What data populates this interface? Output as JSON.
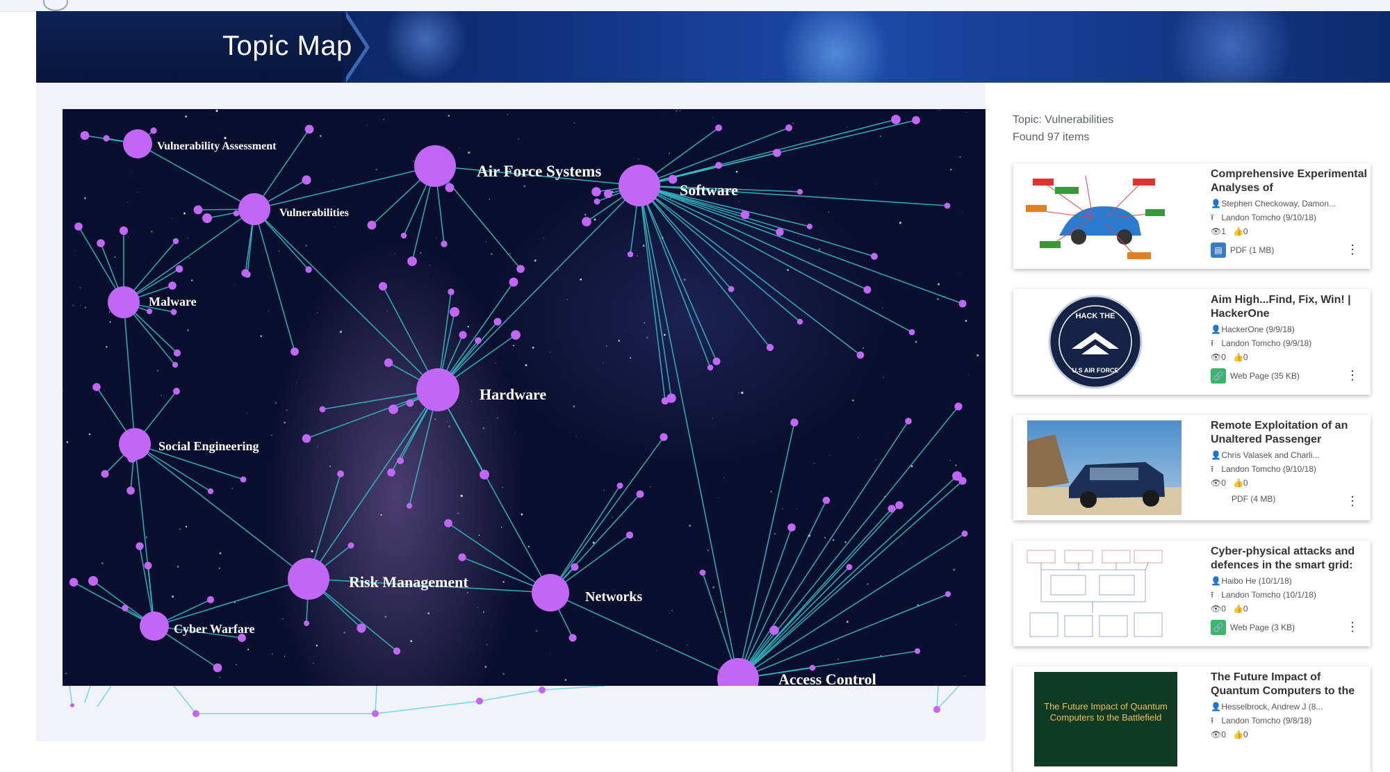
{
  "banner": {
    "title": "Topic Map"
  },
  "panel": {
    "topic_line": "Topic: Vulnerabilities",
    "found_line": "Found 97 items"
  },
  "colors": {
    "node": "#c266f5",
    "edge": "#33c1c9",
    "banner_dark": "#0a1c4a",
    "pdf_icon": "#3a7bc8",
    "link_icon": "#3db56b"
  },
  "topics": [
    {
      "label": "Vulnerability Assessment"
    },
    {
      "label": "Air Force Systems"
    },
    {
      "label": "Software"
    },
    {
      "label": "Vulnerabilities"
    },
    {
      "label": "Malware"
    },
    {
      "label": "Hardware"
    },
    {
      "label": "Social Engineering"
    },
    {
      "label": "Risk Management"
    },
    {
      "label": "Networks"
    },
    {
      "label": "Cyber Warfare"
    },
    {
      "label": "Access Control"
    }
  ],
  "results": [
    {
      "title": "Comprehensive Experimental Analyses of",
      "author": "Stephen Checkoway, Damon...",
      "uploader": "Landon Tomcho (9/10/18)",
      "views": "1",
      "likes": "0",
      "type": "PDF (1 MB)",
      "type_icon": "pdf-icon"
    },
    {
      "title": "Aim High...Find, Fix, Win! | HackerOne",
      "author": "HackerOne (9/9/18)",
      "uploader": "Landon Tomcho (9/9/18)",
      "views": "0",
      "likes": "0",
      "type": "Web Page (35 KB)",
      "type_icon": "link-icon",
      "thumb_text": "HACK THE",
      "thumb_text2": "U.S AIR FORCE"
    },
    {
      "title": "Remote Exploitation of an Unaltered Passenger",
      "author": "Chris Valasek and Charli...",
      "uploader": "Landon Tomcho (9/10/18)",
      "views": "0",
      "likes": "0",
      "type": "PDF (4 MB)",
      "type_icon": "none"
    },
    {
      "title": "Cyber-physical attacks and defences in the smart grid:",
      "author": "Haibo He (10/1/18)",
      "uploader": "Landon Tomcho (10/1/18)",
      "views": "0",
      "likes": "0",
      "type": "Web Page (3 KB)",
      "type_icon": "link-icon"
    },
    {
      "title": "The Future Impact of Quantum Computers to the",
      "author": "Hesselbrock, Andrew J (8...",
      "uploader": "Landon Tomcho (9/8/18)",
      "views": "0",
      "likes": "0",
      "thumb_text": "The Future Impact of Quantum Computers to the Battlefield"
    }
  ]
}
